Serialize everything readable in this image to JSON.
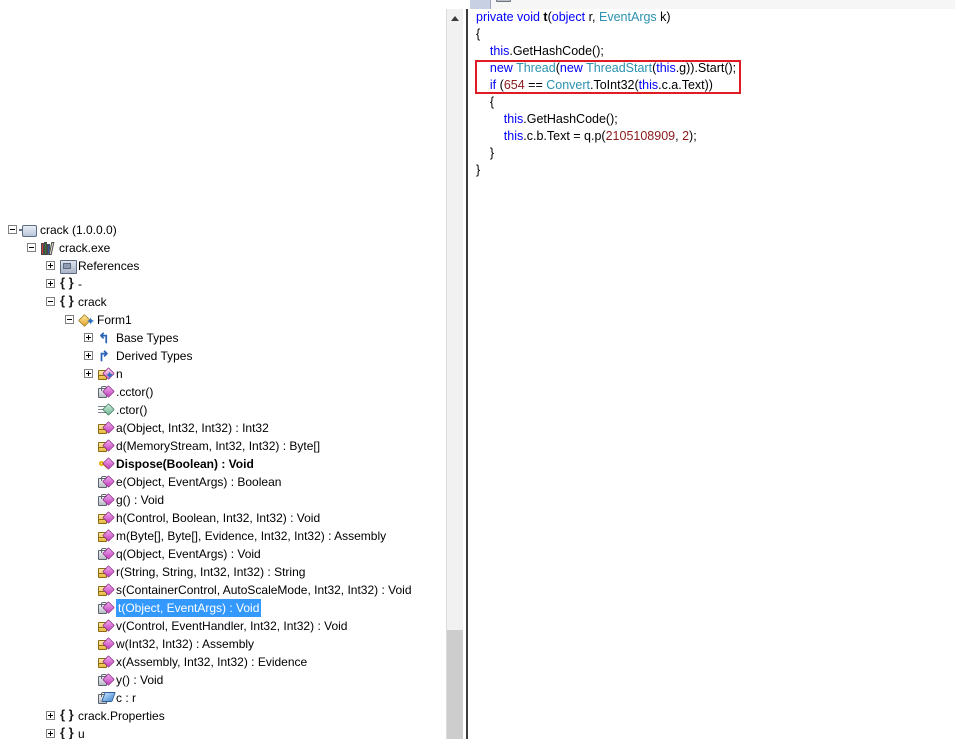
{
  "tabstrip": {
    "active_tab_label": "",
    "tab_icon": "document-icon"
  },
  "tree": {
    "nodes": [
      {
        "depth": 0,
        "expander": "minus",
        "icon": "assembly-list-icon",
        "label": "crack (1.0.0.0)",
        "selected": false,
        "bold": false
      },
      {
        "depth": 1,
        "expander": "minus",
        "icon": "assembly-icon",
        "label": "crack.exe",
        "selected": false,
        "bold": false
      },
      {
        "depth": 2,
        "expander": "plus",
        "icon": "references-icon",
        "label": "References",
        "selected": false,
        "bold": false
      },
      {
        "depth": 2,
        "expander": "plus",
        "icon": "namespace-icon",
        "label": "-",
        "selected": false,
        "bold": false
      },
      {
        "depth": 2,
        "expander": "minus",
        "icon": "namespace-icon",
        "label": "crack",
        "selected": false,
        "bold": false
      },
      {
        "depth": 3,
        "expander": "minus",
        "icon": "class-icon",
        "label": "Form1",
        "selected": false,
        "bold": false
      },
      {
        "depth": 4,
        "expander": "plus",
        "icon": "base-types-icon",
        "label": "Base Types",
        "selected": false,
        "bold": false
      },
      {
        "depth": 4,
        "expander": "plus",
        "icon": "derived-types-icon",
        "label": "Derived Types",
        "selected": false,
        "bold": false
      },
      {
        "depth": 4,
        "expander": "plus",
        "icon": "delegate-icon",
        "label": "n",
        "selected": false,
        "bold": false
      },
      {
        "depth": 4,
        "expander": "none",
        "icon": "method-private-icon",
        "label": ".cctor()",
        "selected": false,
        "bold": false
      },
      {
        "depth": 4,
        "expander": "none",
        "icon": "constructor-icon",
        "label": ".ctor()",
        "selected": false,
        "bold": false
      },
      {
        "depth": 4,
        "expander": "none",
        "icon": "method-internal-icon",
        "label": "a(Object, Int32, Int32) : Int32",
        "selected": false,
        "bold": false
      },
      {
        "depth": 4,
        "expander": "none",
        "icon": "method-internal-icon",
        "label": "d(MemoryStream, Int32, Int32) : Byte[]",
        "selected": false,
        "bold": false
      },
      {
        "depth": 4,
        "expander": "none",
        "icon": "method-override-icon",
        "label": "Dispose(Boolean) : Void",
        "selected": false,
        "bold": true
      },
      {
        "depth": 4,
        "expander": "none",
        "icon": "method-private-icon",
        "label": "e(Object, EventArgs) : Boolean",
        "selected": false,
        "bold": false
      },
      {
        "depth": 4,
        "expander": "none",
        "icon": "method-private-icon",
        "label": "g() : Void",
        "selected": false,
        "bold": false
      },
      {
        "depth": 4,
        "expander": "none",
        "icon": "method-internal-icon",
        "label": "h(Control, Boolean, Int32, Int32) : Void",
        "selected": false,
        "bold": false
      },
      {
        "depth": 4,
        "expander": "none",
        "icon": "method-internal-icon",
        "label": "m(Byte[], Byte[], Evidence, Int32, Int32) : Assembly",
        "selected": false,
        "bold": false
      },
      {
        "depth": 4,
        "expander": "none",
        "icon": "method-private-icon",
        "label": "q(Object, EventArgs) : Void",
        "selected": false,
        "bold": false
      },
      {
        "depth": 4,
        "expander": "none",
        "icon": "method-internal-icon",
        "label": "r(String, String, Int32, Int32) : String",
        "selected": false,
        "bold": false
      },
      {
        "depth": 4,
        "expander": "none",
        "icon": "method-internal-icon",
        "label": "s(ContainerControl, AutoScaleMode, Int32, Int32) : Void",
        "selected": false,
        "bold": false
      },
      {
        "depth": 4,
        "expander": "none",
        "icon": "method-private-icon",
        "label": "t(Object, EventArgs) : Void",
        "selected": true,
        "bold": false
      },
      {
        "depth": 4,
        "expander": "none",
        "icon": "method-internal-icon",
        "label": "v(Control, EventHandler, Int32, Int32) : Void",
        "selected": false,
        "bold": false
      },
      {
        "depth": 4,
        "expander": "none",
        "icon": "method-internal-icon",
        "label": "w(Int32, Int32) : Assembly",
        "selected": false,
        "bold": false
      },
      {
        "depth": 4,
        "expander": "none",
        "icon": "method-internal-icon",
        "label": "x(Assembly, Int32, Int32) : Evidence",
        "selected": false,
        "bold": false
      },
      {
        "depth": 4,
        "expander": "none",
        "icon": "method-private-icon",
        "label": "y() : Void",
        "selected": false,
        "bold": false
      },
      {
        "depth": 4,
        "expander": "none",
        "icon": "field-icon",
        "label": "c : r",
        "selected": false,
        "bold": false
      },
      {
        "depth": 2,
        "expander": "plus",
        "icon": "namespace-icon",
        "label": "crack.Properties",
        "selected": false,
        "bold": false
      },
      {
        "depth": 2,
        "expander": "plus",
        "icon": "namespace-icon",
        "label": "u",
        "selected": false,
        "bold": false
      }
    ]
  },
  "scrollbar": {
    "up_arrow": "scroll-up-arrow-icon"
  },
  "code": {
    "lines": [
      [
        {
          "t": "private ",
          "c": "kw"
        },
        {
          "t": "void ",
          "c": "kw"
        },
        {
          "t": "t",
          "c": "mth"
        },
        {
          "t": "(",
          "c": "pln"
        },
        {
          "t": "object",
          "c": "kw"
        },
        {
          "t": " r, ",
          "c": "pln"
        },
        {
          "t": "EventArgs",
          "c": "typ"
        },
        {
          "t": " k)",
          "c": "pln"
        }
      ],
      [
        {
          "t": "{",
          "c": "pln"
        }
      ],
      [
        {
          "t": "    ",
          "c": "pln"
        },
        {
          "t": "this",
          "c": "kw"
        },
        {
          "t": ".GetHashCode();",
          "c": "pln"
        }
      ],
      [
        {
          "t": "    ",
          "c": "pln"
        },
        {
          "t": "new ",
          "c": "kw"
        },
        {
          "t": "Thread",
          "c": "typ"
        },
        {
          "t": "(",
          "c": "pln"
        },
        {
          "t": "new ",
          "c": "kw"
        },
        {
          "t": "ThreadStart",
          "c": "typ"
        },
        {
          "t": "(",
          "c": "pln"
        },
        {
          "t": "this",
          "c": "kw"
        },
        {
          "t": ".g)).Start();",
          "c": "pln"
        }
      ],
      [
        {
          "t": "    ",
          "c": "pln"
        },
        {
          "t": "if ",
          "c": "kw"
        },
        {
          "t": "(",
          "c": "pln"
        },
        {
          "t": "654",
          "c": "num"
        },
        {
          "t": " == ",
          "c": "pln"
        },
        {
          "t": "Convert",
          "c": "typ"
        },
        {
          "t": ".ToInt32(",
          "c": "pln"
        },
        {
          "t": "this",
          "c": "kw"
        },
        {
          "t": ".c.a.Text))",
          "c": "pln"
        }
      ],
      [
        {
          "t": "    {",
          "c": "pln"
        }
      ],
      [
        {
          "t": "        ",
          "c": "pln"
        },
        {
          "t": "this",
          "c": "kw"
        },
        {
          "t": ".GetHashCode();",
          "c": "pln"
        }
      ],
      [
        {
          "t": "        ",
          "c": "pln"
        },
        {
          "t": "this",
          "c": "kw"
        },
        {
          "t": ".c.b.Text = q.p(",
          "c": "pln"
        },
        {
          "t": "2105108909",
          "c": "num"
        },
        {
          "t": ", ",
          "c": "pln"
        },
        {
          "t": "2",
          "c": "num"
        },
        {
          "t": ");",
          "c": "pln"
        }
      ],
      [
        {
          "t": "    }",
          "c": "pln"
        }
      ],
      [
        {
          "t": "}",
          "c": "pln"
        }
      ]
    ]
  },
  "annotation": {
    "box_color": "#e01b24",
    "covers_lines": [
      "new Thread(new ThreadStart(this.g)).Start();",
      "if (654 == Convert.ToInt32(this.c.a.Text))"
    ]
  },
  "colors": {
    "selection": "#3399ff",
    "keyword": "#0000ff",
    "type": "#2b91af",
    "number": "#8b1a1a",
    "annotation": "#e01b24"
  }
}
